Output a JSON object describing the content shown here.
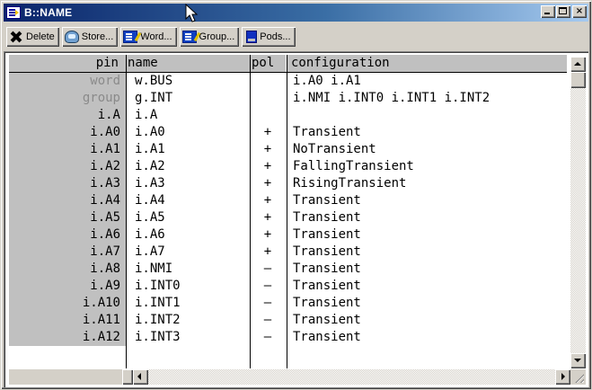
{
  "window": {
    "title": "B::NAME",
    "controls": [
      "minimize",
      "maximize",
      "close"
    ]
  },
  "toolbar": {
    "buttons": [
      {
        "label": "Delete",
        "icon": "delete-icon"
      },
      {
        "label": "Store...",
        "icon": "store-icon"
      },
      {
        "label": "Word...",
        "icon": "word-icon"
      },
      {
        "label": "Group...",
        "icon": "group-icon"
      },
      {
        "label": "Pods...",
        "icon": "pods-icon"
      }
    ]
  },
  "table": {
    "headers": {
      "pin": "pin",
      "name": "name",
      "pol": "pol",
      "configuration": "configuration"
    },
    "rows": [
      {
        "pin": "word",
        "name": "w.BUS",
        "pol": "",
        "configuration": "i.A0 i.A1",
        "dim": true
      },
      {
        "pin": "group",
        "name": "g.INT",
        "pol": "",
        "configuration": "i.NMI i.INT0 i.INT1 i.INT2",
        "dim": true
      },
      {
        "pin": "i.A",
        "name": "i.A",
        "pol": "",
        "configuration": ""
      },
      {
        "pin": "i.A0",
        "name": "i.A0",
        "pol": "+",
        "configuration": "Transient"
      },
      {
        "pin": "i.A1",
        "name": "i.A1",
        "pol": "+",
        "configuration": "NoTransient"
      },
      {
        "pin": "i.A2",
        "name": "i.A2",
        "pol": "+",
        "configuration": "FallingTransient"
      },
      {
        "pin": "i.A3",
        "name": "i.A3",
        "pol": "+",
        "configuration": "RisingTransient"
      },
      {
        "pin": "i.A4",
        "name": "i.A4",
        "pol": "+",
        "configuration": "Transient"
      },
      {
        "pin": "i.A5",
        "name": "i.A5",
        "pol": "+",
        "configuration": "Transient"
      },
      {
        "pin": "i.A6",
        "name": "i.A6",
        "pol": "+",
        "configuration": "Transient"
      },
      {
        "pin": "i.A7",
        "name": "i.A7",
        "pol": "+",
        "configuration": "Transient"
      },
      {
        "pin": "i.A8",
        "name": "i.NMI",
        "pol": "–",
        "configuration": "Transient"
      },
      {
        "pin": "i.A9",
        "name": "i.INT0",
        "pol": "–",
        "configuration": "Transient"
      },
      {
        "pin": "i.A10",
        "name": "i.INT1",
        "pol": "–",
        "configuration": "Transient"
      },
      {
        "pin": "i.A11",
        "name": "i.INT2",
        "pol": "–",
        "configuration": "Transient"
      },
      {
        "pin": "i.A12",
        "name": "i.INT3",
        "pol": "–",
        "configuration": "Transient"
      }
    ]
  },
  "colors": {
    "title_active": "#0a246a",
    "title_gradient_end": "#a6caf0",
    "face": "#d4d0c8",
    "pin_column": "#c0c0c0",
    "dim_text": "#8a8a8a"
  }
}
